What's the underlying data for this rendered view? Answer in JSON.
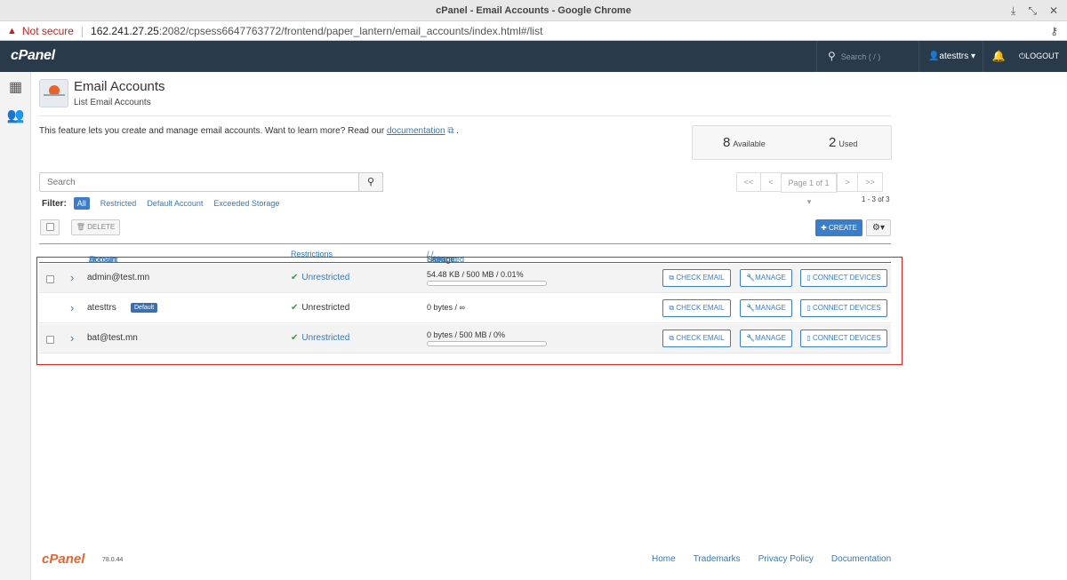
{
  "browser": {
    "window_title": "cPanel - Email Accounts - Google Chrome",
    "security_label": "Not secure",
    "url_host": "162.241.27.25",
    "url_rest": ":2082/cpsess6647763772/frontend/paper_lantern/email_accounts/index.html#/list"
  },
  "topnav": {
    "logo": "cPanel",
    "search_placeholder": "Search ( / )",
    "username": "atesttrs",
    "logout_label": "LOGOUT"
  },
  "header": {
    "title": "Email Accounts",
    "subtitle": "List Email Accounts"
  },
  "intro": {
    "text": "This feature lets you create and manage email accounts. Want to learn more? Read our",
    "link": "documentation",
    "tail": "."
  },
  "stats": {
    "available_count": "8",
    "available_label": "Available",
    "used_count": "2",
    "used_label": "Used"
  },
  "search": {
    "placeholder": "Search"
  },
  "pager": {
    "first": "<<",
    "prev": "<",
    "page_label": "Page 1 of 1",
    "next": ">",
    "last": ">>",
    "records": "1 - 3 of 3"
  },
  "filter": {
    "label": "Filter:",
    "options": [
      "All",
      "Restricted",
      "Default Account",
      "Exceeded Storage"
    ]
  },
  "toolbar": {
    "delete_label": "DELETE",
    "create_label": "CREATE"
  },
  "table": {
    "col_account": "Account",
    "col_at": "@",
    "col_domain": "Domain",
    "col_restrictions": "Restrictions",
    "col_storage": "Storage:",
    "col_used": "Used",
    "col_allocated": "Allocated",
    "col_percent": "%",
    "rows": [
      {
        "account": "admin@test.mn",
        "badge": "",
        "restriction": "Unrestricted",
        "storage": "54.48 KB / 500 MB / 0.01%",
        "usage_percent": 0.01
      },
      {
        "account": "atesttrs",
        "badge": "Default",
        "restriction": "Unrestricted",
        "storage": "0 bytes / ∞",
        "usage_percent": null
      },
      {
        "account": "bat@test.mn",
        "badge": "",
        "restriction": "Unrestricted",
        "storage": "0 bytes / 500 MB / 0%",
        "usage_percent": 0
      }
    ],
    "actions": {
      "check_email": "CHECK EMAIL",
      "manage": "MANAGE",
      "connect_devices": "CONNECT DEVICES"
    }
  },
  "footer": {
    "logo": "cPanel",
    "version": "78.0.44",
    "links": [
      "Home",
      "Trademarks",
      "Privacy Policy",
      "Documentation"
    ]
  },
  "colors": {
    "nav_bg": "#293a4a",
    "primary": "#3a7dc9",
    "brand_orange": "#e8632b",
    "highlight_red": "#e0201b"
  }
}
